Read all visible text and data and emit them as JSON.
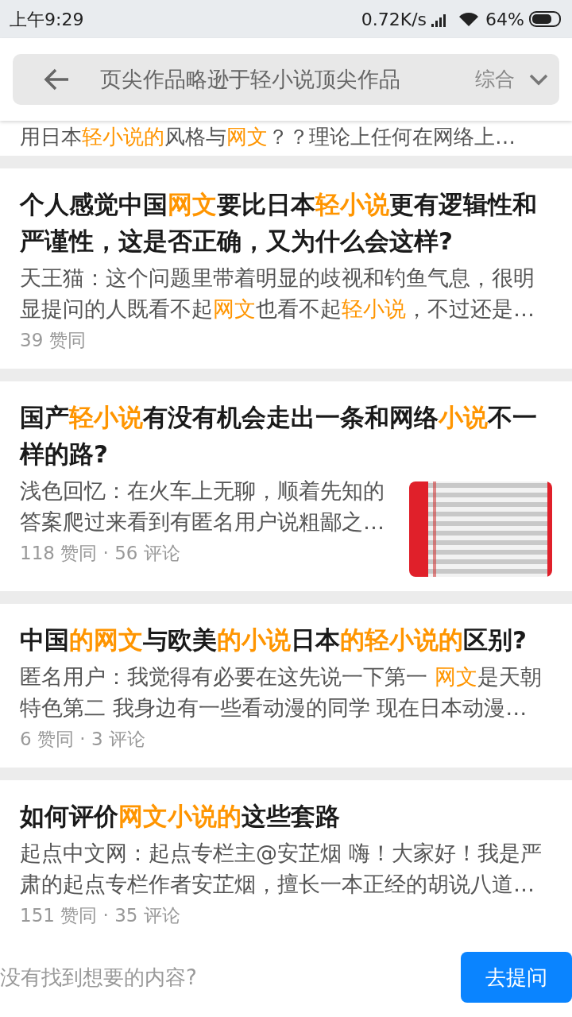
{
  "status_bar": {
    "time": "上午9:29",
    "speed": "0.72K/s",
    "battery": "64%"
  },
  "search": {
    "query": "页尖作品略逊于轻小说顶尖作品",
    "filter": "综合"
  },
  "partial_line": [
    {
      "text": "用日本"
    },
    {
      "text": "轻小说的",
      "highlight": true
    },
    {
      "text": "风格与"
    },
    {
      "text": "网文",
      "highlight": true
    },
    {
      "text": "？？理论上任何在网络上…"
    }
  ],
  "results": [
    {
      "title": [
        {
          "text": "个人感觉中国"
        },
        {
          "text": "网文",
          "highlight": true
        },
        {
          "text": "要比日本"
        },
        {
          "text": "轻小说",
          "highlight": true
        },
        {
          "text": "更有逻辑性和严谨性，这是否正确，又为什么会这样?"
        }
      ],
      "excerpt": [
        {
          "text": "天王猫：这个问题里带着明显的歧视和钓鱼气息，很明显提问的人既看不起"
        },
        {
          "text": "网文",
          "highlight": true
        },
        {
          "text": "也看不起"
        },
        {
          "text": "轻小说",
          "highlight": true
        },
        {
          "text": "，不过还是…"
        }
      ],
      "meta": "39 赞同"
    },
    {
      "title": [
        {
          "text": "国产"
        },
        {
          "text": "轻小说",
          "highlight": true
        },
        {
          "text": "有没有机会走出一条和网络"
        },
        {
          "text": "小说",
          "highlight": true
        },
        {
          "text": "不一样的路?"
        }
      ],
      "excerpt": [
        {
          "text": "浅色回忆：在火车上无聊，顺着先知的答案爬过来看到有匿名用户说粗鄙之…"
        }
      ],
      "meta": "118 赞同 · 56 评论"
    },
    {
      "title": [
        {
          "text": "中国"
        },
        {
          "text": "的网文",
          "highlight": true
        },
        {
          "text": "与欧美"
        },
        {
          "text": "的小说",
          "highlight": true
        },
        {
          "text": "日本"
        },
        {
          "text": "的轻小说的",
          "highlight": true
        },
        {
          "text": "区别?"
        }
      ],
      "excerpt": [
        {
          "text": "匿名用户：我觉得有必要在这先说一下第一 "
        },
        {
          "text": "网文",
          "highlight": true
        },
        {
          "text": "是天朝特色第二 我身边有一些看动漫的同学 现在日本动漫…"
        }
      ],
      "meta": "6 赞同 · 3 评论"
    },
    {
      "title": [
        {
          "text": "如何评价"
        },
        {
          "text": "网文小说的",
          "highlight": true
        },
        {
          "text": "这些套路"
        }
      ],
      "excerpt": [
        {
          "text": "起点中文网：起点专栏主@安芷烟 嗨！大家好！我是严肃的起点专栏作者安芷烟，擅长一本正经的胡说八道…"
        }
      ],
      "meta": "151 赞同 · 35 评论"
    }
  ],
  "bottom_bar": {
    "prompt": "没有找到想要的内容?",
    "button": "去提问"
  }
}
